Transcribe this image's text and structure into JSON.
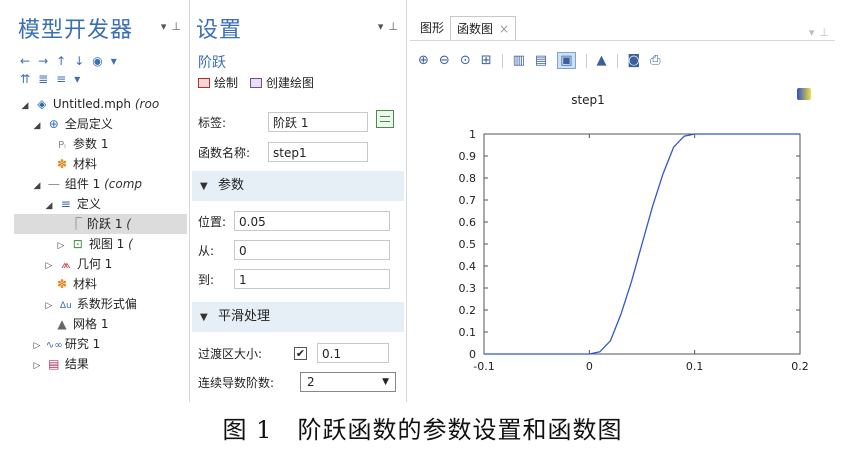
{
  "model_builder": {
    "title": "模型开发器",
    "tree": [
      {
        "icon": "file-icon",
        "label": "Untitled.mph",
        "suffix": "(roo"
      },
      {
        "icon": "globe-icon",
        "label": "全局定义",
        "suffix": ""
      },
      {
        "icon": "parameters-icon",
        "label": "参数 1",
        "suffix": ""
      },
      {
        "icon": "materials-icon",
        "label": "材料",
        "suffix": ""
      },
      {
        "icon": "component-icon",
        "label": "组件 1",
        "suffix": "(comp"
      },
      {
        "icon": "definitions-icon",
        "label": "定义",
        "suffix": ""
      },
      {
        "icon": "step-function-icon",
        "label": "阶跃 1",
        "suffix": "("
      },
      {
        "icon": "view-icon",
        "label": "视图 1",
        "suffix": "("
      },
      {
        "icon": "geometry-icon",
        "label": "几何 1",
        "suffix": ""
      },
      {
        "icon": "materials-icon",
        "label": "材料",
        "suffix": ""
      },
      {
        "icon": "coefficient-pde-icon",
        "label": "系数形式偏",
        "suffix": ""
      },
      {
        "icon": "mesh-icon",
        "label": "网格 1",
        "suffix": ""
      },
      {
        "icon": "study-icon",
        "label": "研究 1",
        "suffix": ""
      },
      {
        "icon": "results-icon",
        "label": "结果",
        "suffix": ""
      }
    ]
  },
  "settings": {
    "title": "设置",
    "subtitle": "阶跃",
    "plot_label": "绘制",
    "create_plot_label": "创建绘图",
    "tag_label": "标签:",
    "tag_value": "阶跃 1",
    "function_name_label": "函数名称:",
    "function_name_value": "step1",
    "params_section": "参数",
    "location_label": "位置:",
    "location_value": "0.05",
    "from_label": "从:",
    "from_value": "0",
    "to_label": "到:",
    "to_value": "1",
    "smoothing_section": "平滑处理",
    "transition_label": "过渡区大小:",
    "transition_checked": "✔",
    "transition_value": "0.1",
    "derivatives_label": "连续导数阶数:",
    "derivatives_value": "2"
  },
  "graphics": {
    "tab_graphics": "图形",
    "tab_function": "函数图",
    "tab_close": "×",
    "plot_title": "step1",
    "line_color": "#3355cc"
  },
  "chart_data": {
    "type": "line",
    "title": "step1",
    "xlabel": "",
    "ylabel": "",
    "xlim": [
      -0.1,
      0.2
    ],
    "ylim": [
      0,
      1
    ],
    "xticks": [
      "-0.1",
      "0",
      "0.1",
      "0.2"
    ],
    "yticks": [
      "0",
      "0.1",
      "0.2",
      "0.3",
      "0.4",
      "0.5",
      "0.6",
      "0.7",
      "0.8",
      "0.9",
      "1"
    ],
    "series": [
      {
        "x": [
          -0.1,
          0.0,
          0.01,
          0.02,
          0.03,
          0.04,
          0.05,
          0.06,
          0.07,
          0.08,
          0.09,
          0.1,
          0.2
        ],
        "y": [
          0,
          0,
          0.01,
          0.06,
          0.18,
          0.33,
          0.5,
          0.67,
          0.82,
          0.94,
          0.99,
          1,
          1
        ]
      }
    ]
  },
  "caption": "图 1　阶跃函数的参数设置和函数图"
}
